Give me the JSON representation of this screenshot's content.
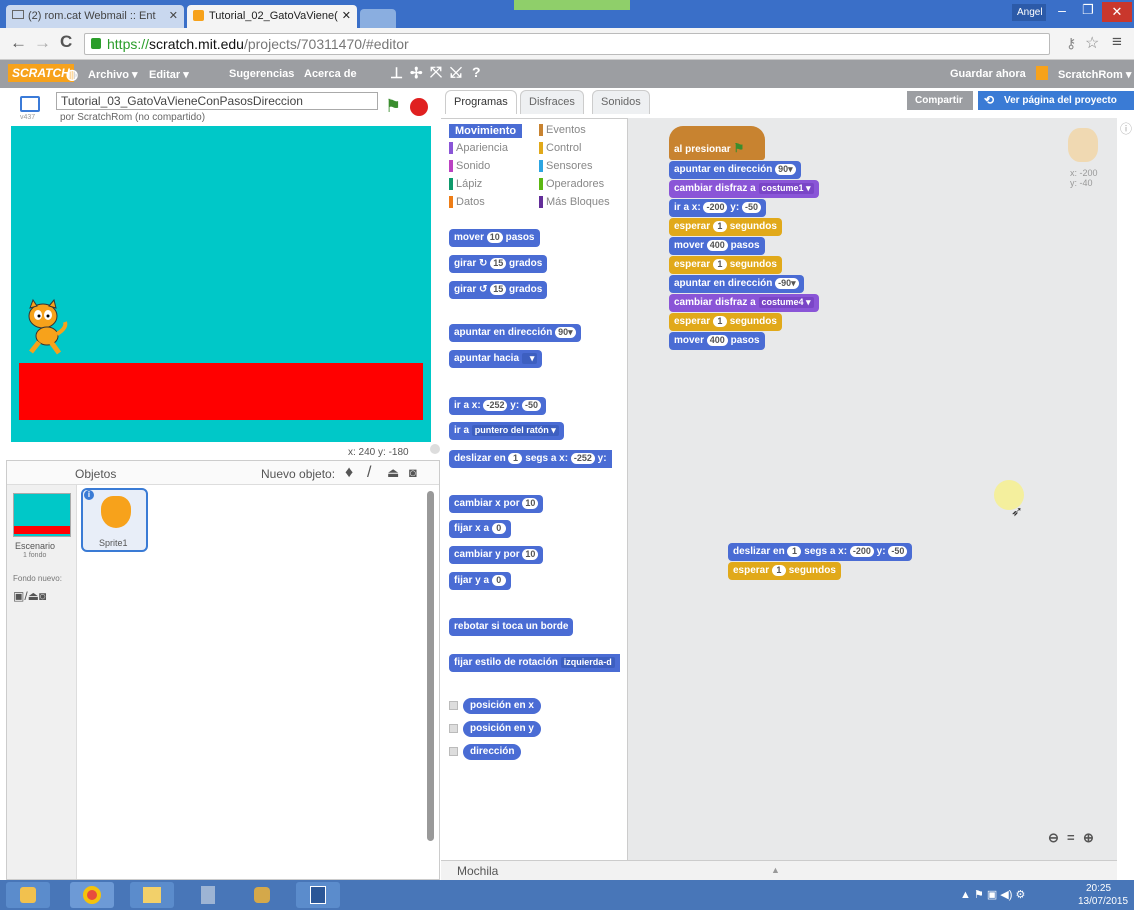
{
  "browser": {
    "tabs": [
      {
        "label": "(2) rom.cat Webmail :: Ent"
      },
      {
        "label": "Tutorial_02_GatoVaViene("
      }
    ],
    "user_badge": "Angel",
    "url_scheme": "https://",
    "url_host": "scratch.mit.edu",
    "url_path": "/projects/70311470/#editor"
  },
  "scratch_menu": {
    "logo": "SCRATCH",
    "items": [
      "Archivo ▾",
      "Editar ▾",
      "Sugerencias",
      "Acerca de"
    ],
    "save": "Guardar ahora",
    "user": "ScratchRom ▾"
  },
  "stage": {
    "version": "v437",
    "project_title": "Tutorial_03_GatoVaVieneConPasosDireccion",
    "owner": "por ScratchRom (no compartido)",
    "coords": "x: 240  y: -180"
  },
  "sprites": {
    "header": "Objetos",
    "new_object": "Nuevo objeto:",
    "stage_label": "Escenario",
    "stage_sub": "1 fondo",
    "new_bg": "Fondo nuevo:",
    "sprite1": "Sprite1"
  },
  "editor_tabs": [
    "Programas",
    "Disfraces",
    "Sonidos"
  ],
  "share": "Compartir",
  "see_page": "Ver página del proyecto",
  "categories": [
    {
      "name": "Movimiento",
      "color": "#4a6cd4"
    },
    {
      "name": "Eventos",
      "color": "#c88330"
    },
    {
      "name": "Apariencia",
      "color": "#8a55d7"
    },
    {
      "name": "Control",
      "color": "#e1a91a"
    },
    {
      "name": "Sonido",
      "color": "#bb42c3"
    },
    {
      "name": "Sensores",
      "color": "#2ca5e2"
    },
    {
      "name": "Lápiz",
      "color": "#0e9a6c"
    },
    {
      "name": "Operadores",
      "color": "#5cb712"
    },
    {
      "name": "Datos",
      "color": "#ee7d16"
    },
    {
      "name": "Más Bloques",
      "color": "#632d99"
    }
  ],
  "palette": {
    "mover": "mover",
    "mover_n": "10",
    "pasos": "pasos",
    "girar": "girar",
    "girar_n": "15",
    "grados": "grados",
    "apuntar_dir": "apuntar en dirección",
    "apuntar_dir_n": "90▾",
    "apuntar_hacia": "apuntar hacia",
    "ir_a_x": "ir a x:",
    "ir_x": "-252",
    "y": "y:",
    "ir_y": "-50",
    "ir_a": "ir a",
    "ir_a_dd": "puntero del ratón ▾",
    "deslizar": "deslizar en",
    "deslizar_n": "1",
    "segs_a_x": "segs a x:",
    "deslizar_x": "-252",
    "deslizar_y": "y:",
    "cambiar_x": "cambiar x por",
    "cambiar_x_n": "10",
    "fijar_x": "fijar x a",
    "fijar_x_n": "0",
    "cambiar_y": "cambiar y por",
    "cambiar_y_n": "10",
    "fijar_y": "fijar y a",
    "fijar_y_n": "0",
    "rebotar": "rebotar si toca un borde",
    "estilo": "fijar estilo de rotación",
    "estilo_dd": "izquierda-d",
    "pos_x": "posición en x",
    "pos_y": "posición en y",
    "direccion": "dirección"
  },
  "script": {
    "hat": "al presionar",
    "b1": "apuntar en dirección",
    "b1n": "90▾",
    "b2": "cambiar disfraz a",
    "b2d": "costume1 ▾",
    "b3": "ir a x:",
    "b3x": "-200",
    "b3y": "-50",
    "b4": "esperar",
    "b4n": "1",
    "segundos": "segundos",
    "b5": "mover",
    "b5n": "400",
    "pasos": "pasos",
    "b7n": "-90▾",
    "b8d": "costume4 ▾",
    "loose1": "deslizar en",
    "loose1n": "1",
    "loose1x": "-200",
    "loose1y": "-50"
  },
  "sprite_info": {
    "x": "x: -200",
    "y": "y: -40"
  },
  "mochila": "Mochila",
  "clock": {
    "time": "20:25",
    "date": "13/07/2015"
  }
}
